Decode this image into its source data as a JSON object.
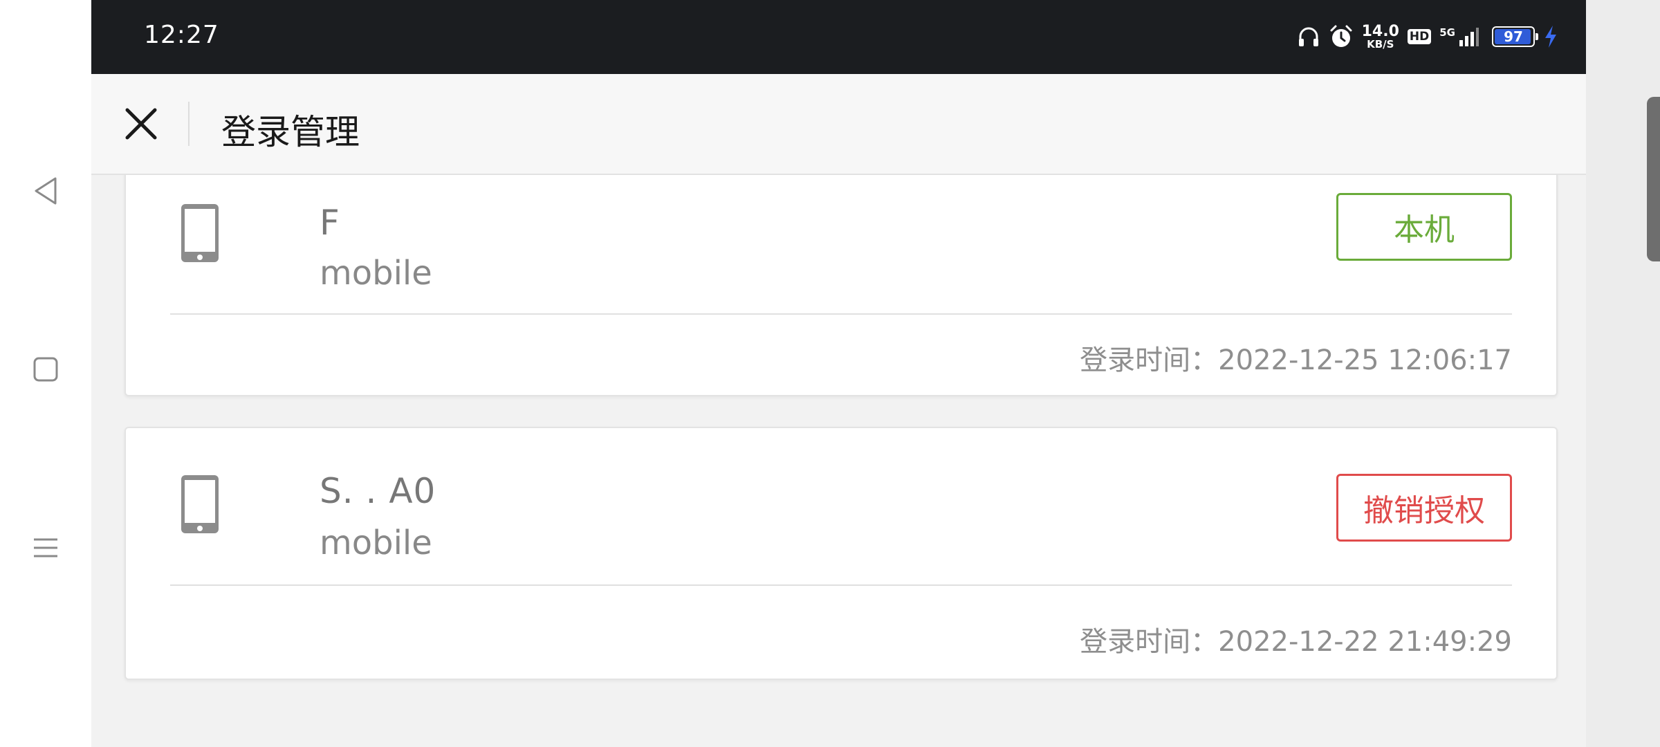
{
  "status_bar": {
    "time": "12:27",
    "net_speed_value": "14.0",
    "net_speed_unit": "KB/S",
    "hd_label": "HD",
    "network_label": "5G",
    "battery_level": "97",
    "battery_fraction": 0.97,
    "battery_color": "#2f5cd8",
    "icons": [
      "headphones-icon",
      "alarm-icon",
      "signal-icon",
      "battery-icon",
      "charging-icon"
    ]
  },
  "nav_rail": {
    "icons": [
      "back-triangle-icon",
      "home-square-icon",
      "menu-lines-icon"
    ]
  },
  "header": {
    "title": "登录管理",
    "close_icon": "close-icon"
  },
  "sessions": [
    {
      "device_name": "F",
      "device_type": "mobile",
      "action_label": "本机",
      "action_kind": "current",
      "location": "",
      "login_time_label": "登录时间：",
      "login_time": "2022-12-25 12:06:17"
    },
    {
      "device_name": "S.   .  A0",
      "device_type": "mobile",
      "action_label": "撤销授权",
      "action_kind": "revoke",
      "location": "",
      "login_time_label": "登录时间：",
      "login_time": "2022-12-22 21:49:29"
    }
  ],
  "colors": {
    "current_accent": "#6aab3a",
    "revoke_accent": "#e04b4b",
    "status_bar_bg": "#1b1d20"
  }
}
